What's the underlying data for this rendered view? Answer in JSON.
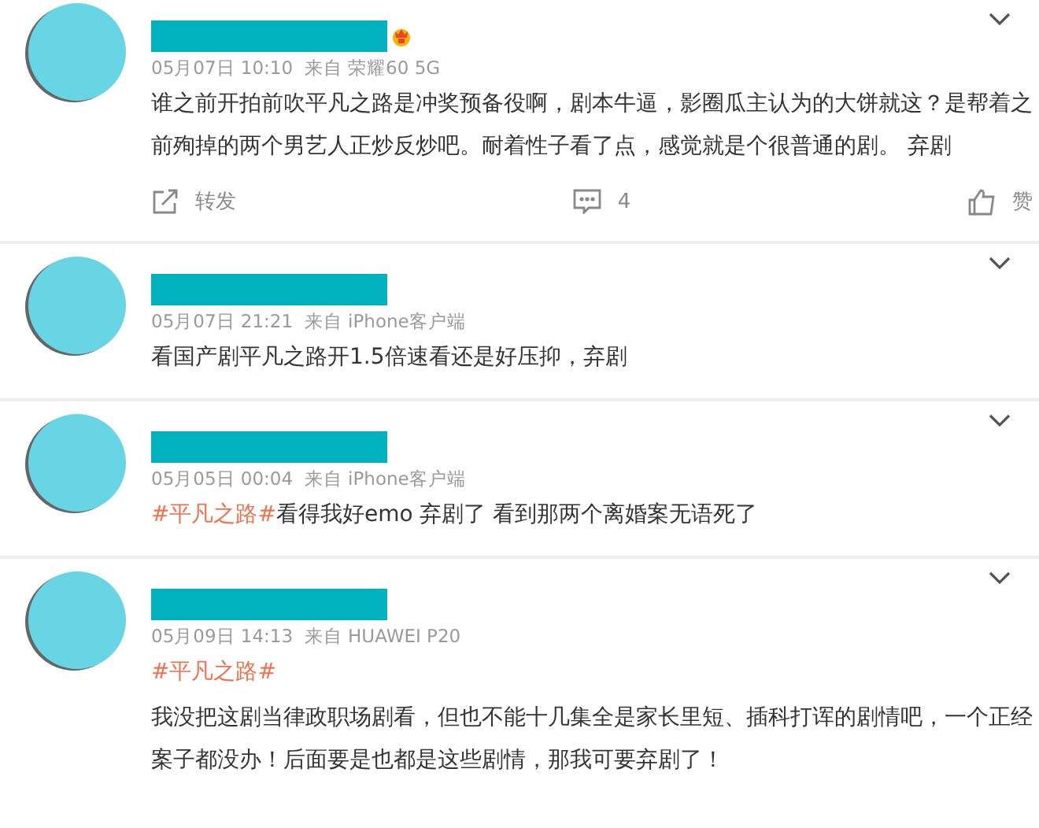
{
  "comments": [
    {
      "badge": true,
      "meta": "05月07日 10:10  来自 荣耀60 5G",
      "paragraphs": [
        {
          "text": "谁之前开拍前吹平凡之路是冲奖预备役啊，剧本牛逼，影圈瓜主认为的大饼就这？是帮着之前殉掉的两个男艺人正炒反炒吧。耐着性子看了点，感觉就是个很普通的剧。 弃剧"
        }
      ],
      "actions": {
        "repost": "转发",
        "comments": "4",
        "like": "赞"
      }
    },
    {
      "badge": false,
      "meta": "05月07日 21:21  来自 iPhone客户端",
      "paragraphs": [
        {
          "text": "看国产剧平凡之路开1.5倍速看还是好压抑，弃剧"
        }
      ]
    },
    {
      "badge": false,
      "meta": "05月05日 00:04  来自 iPhone客户端",
      "paragraphs": [
        {
          "hashtag": "#平凡之路#",
          "text": "看得我好emo 弃剧了 看到那两个离婚案无语死了"
        }
      ]
    },
    {
      "badge": false,
      "meta": "05月09日 14:13  来自 HUAWEI P20",
      "paragraphs": [
        {
          "hashtag": "#平凡之路#"
        },
        {
          "text": "我没把这剧当律政职场剧看，但也不能十几集全是家长里短、插科打诨的剧情吧，一个正经案子都没办！后面要是也都是这些剧情，那我可要弃剧了！"
        }
      ]
    }
  ]
}
